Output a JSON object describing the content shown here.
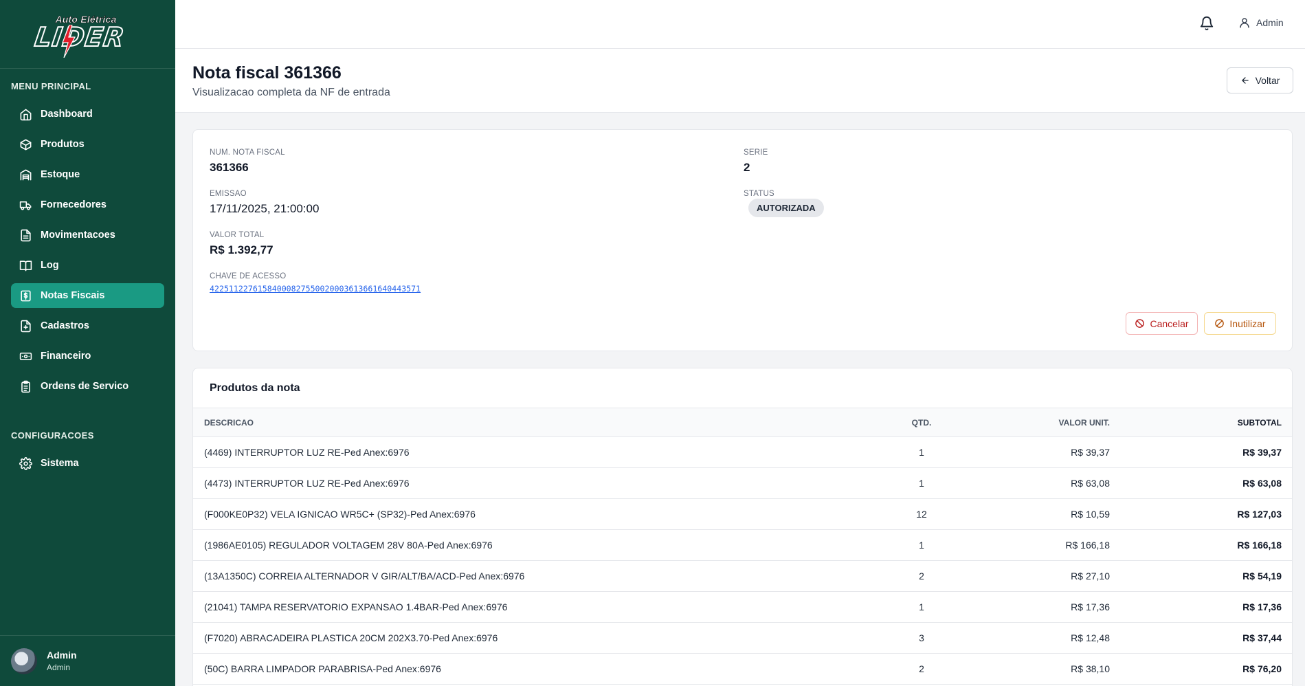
{
  "brand": {
    "logo_top": "Auto Elétrica",
    "logo_main": "LIDER"
  },
  "sidebar": {
    "main_section": "MENU PRINCIPAL",
    "items": [
      {
        "label": "Dashboard",
        "icon": "home-icon"
      },
      {
        "label": "Produtos",
        "icon": "box-icon"
      },
      {
        "label": "Estoque",
        "icon": "warehouse-icon"
      },
      {
        "label": "Fornecedores",
        "icon": "truck-icon"
      },
      {
        "label": "Movimentacoes",
        "icon": "file-icon"
      },
      {
        "label": "Log",
        "icon": "book-icon"
      },
      {
        "label": "Notas Fiscais",
        "icon": "dollar-file-icon",
        "active": true
      },
      {
        "label": "Cadastros",
        "icon": "file-plus-icon"
      },
      {
        "label": "Financeiro",
        "icon": "banknote-icon"
      },
      {
        "label": "Ordens de Servico",
        "icon": "clipboard-icon"
      }
    ],
    "config_section": "CONFIGURACOES",
    "config_items": [
      {
        "label": "Sistema",
        "icon": "gear-icon"
      }
    ],
    "user": {
      "name": "Admin",
      "role": "Admin"
    }
  },
  "topbar": {
    "user_label": "Admin"
  },
  "header": {
    "title": "Nota fiscal 361366",
    "subtitle": "Visualizacao completa da NF de entrada",
    "back_label": "Voltar"
  },
  "invoice": {
    "num_label": "NUM. NOTA FISCAL",
    "num_value": "361366",
    "serie_label": "SERIE",
    "serie_value": "2",
    "emissao_label": "EMISSAO",
    "emissao_value": "17/11/2025, 21:00:00",
    "status_label": "STATUS",
    "status_value": "AUTORIZADA",
    "total_label": "VALOR TOTAL",
    "total_value": "R$ 1.392,77",
    "chave_label": "CHAVE DE ACESSO",
    "chave_value": "42251122761584000827550020003613661640443571",
    "cancel_label": "Cancelar",
    "inutilizar_label": "Inutilizar"
  },
  "products": {
    "title": "Produtos da nota",
    "columns": [
      "DESCRICAO",
      "QTD.",
      "VALOR UNIT.",
      "SUBTOTAL"
    ],
    "rows": [
      [
        "(4469) INTERRUPTOR LUZ RE-Ped Anex:6976",
        "1",
        "R$ 39,37",
        "R$ 39,37"
      ],
      [
        "(4473) INTERRUPTOR LUZ RE-Ped Anex:6976",
        "1",
        "R$ 63,08",
        "R$ 63,08"
      ],
      [
        "(F000KE0P32) VELA IGNICAO WR5C+ (SP32)-Ped Anex:6976",
        "12",
        "R$ 10,59",
        "R$ 127,03"
      ],
      [
        "(1986AE0105) REGULADOR VOLTAGEM 28V 80A-Ped Anex:6976",
        "1",
        "R$ 166,18",
        "R$ 166,18"
      ],
      [
        "(13A1350C) CORREIA ALTERNADOR V GIR/ALT/BA/ACD-Ped Anex:6976",
        "2",
        "R$ 27,10",
        "R$ 54,19"
      ],
      [
        "(21041) TAMPA RESERVATORIO EXPANSAO 1.4BAR-Ped Anex:6976",
        "1",
        "R$ 17,36",
        "R$ 17,36"
      ],
      [
        "(F7020) ABRACADEIRA PLASTICA 20CM 202X3.70-Ped Anex:6976",
        "3",
        "R$ 12,48",
        "R$ 37,44"
      ],
      [
        "(50C) BARRA LIMPADOR PARABRISA-Ped Anex:6976",
        "2",
        "R$ 38,10",
        "R$ 76,20"
      ]
    ]
  },
  "colors": {
    "sidebar": "#0f4a3b",
    "active": "#1a9a83",
    "link": "#2563eb",
    "danger": "#b91c1c",
    "warning": "#b45309"
  }
}
